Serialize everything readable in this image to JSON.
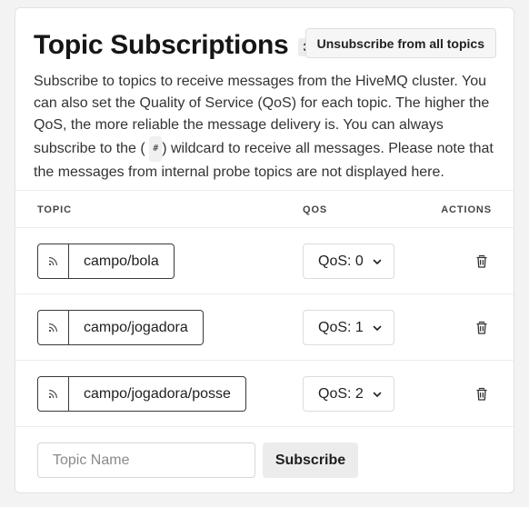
{
  "header": {
    "title": "Topic Subscriptions",
    "count": "3",
    "unsubscribe_all_label": "Unsubscribe from all topics"
  },
  "description": {
    "part1": "Subscribe to topics to receive messages from the HiveMQ cluster. You can also set the Quality of Service (QoS) for each topic. The higher the QoS, the more reliable the message delivery is. You can always subscribe to the (",
    "wildcard": "#",
    "part2": ") wildcard to receive all messages. Please note that the messages from internal probe topics are not displayed here."
  },
  "table": {
    "columns": {
      "topic": "TOPIC",
      "qos": "QOS",
      "actions": "ACTIONS"
    },
    "rows": [
      {
        "topic": "campo/bola",
        "qos": "QoS: 0"
      },
      {
        "topic": "campo/jogadora",
        "qos": "QoS: 1"
      },
      {
        "topic": "campo/jogadora/posse",
        "qos": "QoS: 2"
      }
    ]
  },
  "add": {
    "placeholder": "Topic Name",
    "value": "",
    "subscribe_label": "Subscribe"
  },
  "icons": {
    "feed": "rss-icon",
    "chevron": "chevron-down-icon",
    "delete": "trash-icon"
  }
}
